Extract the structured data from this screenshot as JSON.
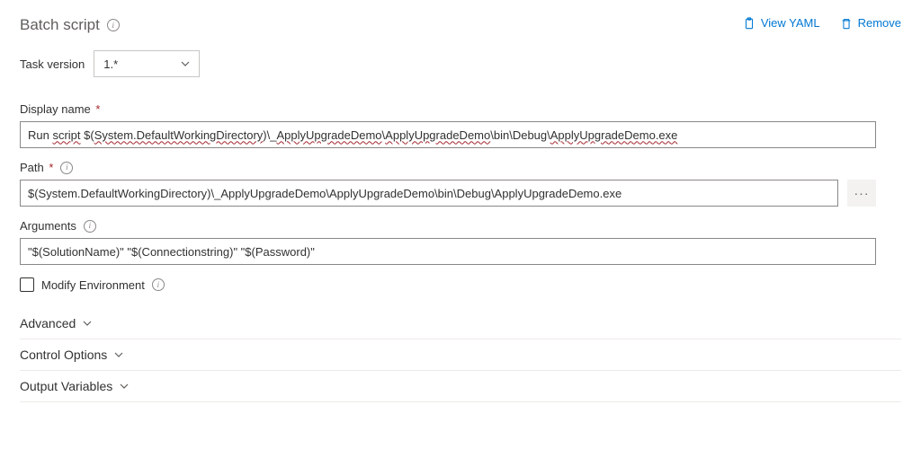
{
  "header": {
    "title": "Batch script",
    "viewYaml": "View YAML",
    "remove": "Remove"
  },
  "taskVersion": {
    "label": "Task version",
    "value": "1.*"
  },
  "displayName": {
    "label": "Display name",
    "value": "Run script $(System.DefaultWorkingDirectory)\\_ApplyUpgradeDemo\\ApplyUpgradeDemo\\bin\\Debug\\ApplyUpgradeDemo.exe"
  },
  "path": {
    "label": "Path",
    "value": "$(System.DefaultWorkingDirectory)\\_ApplyUpgradeDemo\\ApplyUpgradeDemo\\bin\\Debug\\ApplyUpgradeDemo.exe"
  },
  "arguments": {
    "label": "Arguments",
    "value": "\"$(SolutionName)\" \"$(Connectionstring)\" \"$(Password)\""
  },
  "modifyEnv": {
    "label": "Modify Environment",
    "checked": false
  },
  "sections": {
    "advanced": "Advanced",
    "control": "Control Options",
    "output": "Output Variables"
  }
}
